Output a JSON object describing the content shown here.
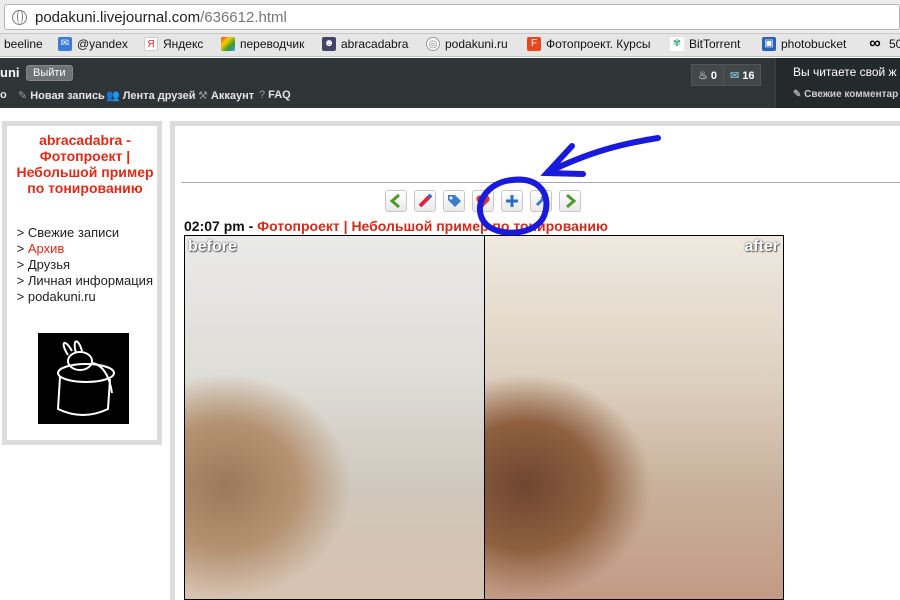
{
  "browser": {
    "url_host": "podakuni.livejournal.com",
    "url_path": "/636612.html"
  },
  "bookmarks": [
    {
      "label": "beeline",
      "icon": "beeline-icon",
      "color": "#f5c400"
    },
    {
      "label": "@yandex",
      "icon": "mail-icon",
      "color": "#3d7bd9"
    },
    {
      "label": "Яндекс",
      "icon": "yandex-icon",
      "color": "#e22"
    },
    {
      "label": "переводчик",
      "icon": "translate-icon",
      "color": "#3c9b2e"
    },
    {
      "label": "abracadabra",
      "icon": "user-icon",
      "color": "#335"
    },
    {
      "label": "podakuni.ru",
      "icon": "globe-icon",
      "color": "#777"
    },
    {
      "label": "Фотопроект. Курсы",
      "icon": "fotoproekt-icon",
      "color": "#e8461c"
    },
    {
      "label": "BitTorrent",
      "icon": "bittorrent-icon",
      "color": "#4a7"
    },
    {
      "label": "photobucket",
      "icon": "photobucket-icon",
      "color": "#2a62b5"
    },
    {
      "label": "50",
      "icon": "infinity-icon",
      "color": "#000"
    }
  ],
  "ljbar": {
    "username": "uni",
    "logout_label": "Выйти",
    "nav": [
      {
        "label": "Новая запись",
        "icon": "pencil-icon"
      },
      {
        "label": "Лента друзей",
        "icon": "friends-icon"
      },
      {
        "label": "Аккаунт",
        "icon": "wrench-icon"
      },
      {
        "label": "FAQ",
        "icon": "question-icon"
      }
    ],
    "nav_prefix": "о",
    "counter_notifications": "0",
    "counter_messages": "16",
    "right_title": "Вы читаете свой ж",
    "right_sub": "Свежие комментар"
  },
  "sidebar": {
    "title": "abracadabra - Фотопроект | Небольшой пример по тонированию",
    "menu": [
      {
        "label": "Свежие записи",
        "active": false
      },
      {
        "label": "Архив",
        "active": true
      },
      {
        "label": "Друзья",
        "active": false
      },
      {
        "label": "Личная информация",
        "active": false
      },
      {
        "label": "podakuni.ru",
        "active": false
      }
    ],
    "menu_marker": ">"
  },
  "post": {
    "time": "02:07 pm",
    "separator": " - ",
    "title": "Фотопроект | Небольшой пример по тонированию",
    "toolbar_icons": [
      "prev-arrow-icon",
      "edit-pencil-icon",
      "tag-icon",
      "favorite-heart-icon",
      "add-plus-icon",
      "pin-icon",
      "next-arrow-icon"
    ],
    "photo_before_label": "before",
    "photo_after_label": "after"
  },
  "annotation": {
    "color": "#1a1adc"
  }
}
